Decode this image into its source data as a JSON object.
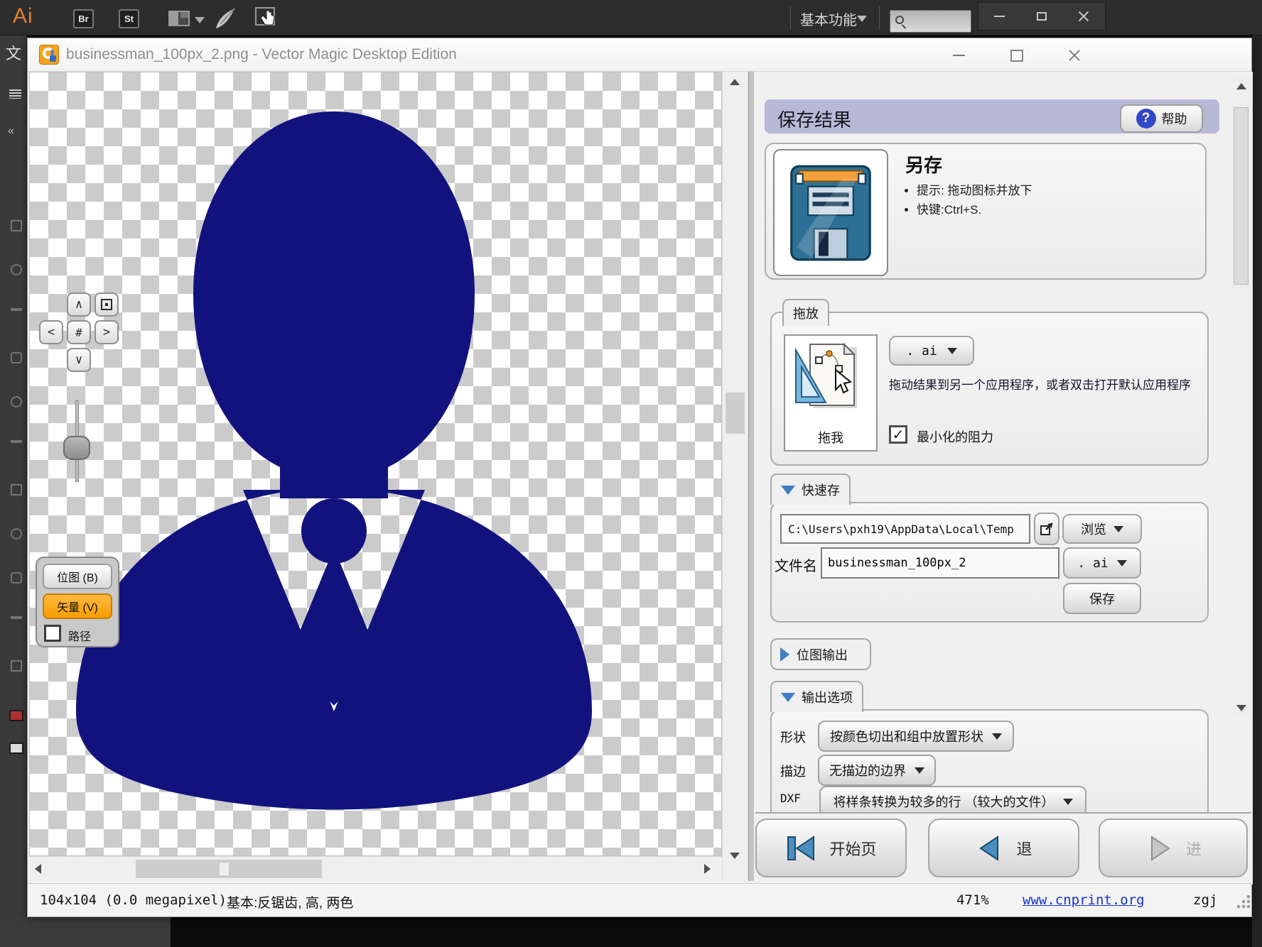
{
  "illustrator": {
    "logo": "Ai",
    "buttons": {
      "bridge": "Br",
      "stock": "St"
    },
    "workspace": "基本功能",
    "file_menu_partial": "文",
    "collapse_glyph": "«"
  },
  "vm": {
    "title": "businessman_100px_2.png - Vector Magic Desktop Edition"
  },
  "canvas": {
    "silhouette_color": "#12127f",
    "nav": {
      "up": "∧",
      "down": "∨",
      "left": "<",
      "right": ">"
    },
    "toggle": {
      "bitmap": "位图 (B)",
      "vector": "矢量 (V)",
      "path": "路径"
    }
  },
  "panel": {
    "header": {
      "title": "保存结果",
      "help_q": "?",
      "help": "帮助"
    },
    "save_as": {
      "heading": "另存",
      "tip1": "提示: 拖动图标并放下",
      "tip2": "快键:Ctrl+S."
    },
    "drag": {
      "tab": "拖放",
      "drag_me": "拖我",
      "format": ". ai",
      "desc": "拖动结果到另一个应用程序，或者双击打开默认应用程序",
      "check_glyph": "✓",
      "check_label": "最小化的阻力"
    },
    "quick": {
      "tab": "快速存",
      "path": "C:\\Users\\pxh19\\AppData\\Local\\Temp",
      "browse": "浏览",
      "file_label": "文件名",
      "filename": "businessman_100px_2",
      "format": ". ai",
      "save": "保存"
    },
    "bitmap_tab": "位图输出",
    "output": {
      "tab": "输出选项",
      "rows": [
        {
          "label": "形状",
          "value": "按颜色切出和组中放置形状"
        },
        {
          "label": "描边",
          "value": "无描边的边界"
        },
        {
          "label": "DXF",
          "value": "将样条转换为较多的行 （较大的文件）"
        }
      ]
    },
    "nav": {
      "start": "开始页",
      "back": "退",
      "forward": "进"
    }
  },
  "status": {
    "size": "104x104 (0.0 megapixel)",
    "mode": "基本:反锯齿, 高, 两色",
    "zoom": "471%",
    "link": "www.cnprint.org",
    "user": "zgj"
  }
}
